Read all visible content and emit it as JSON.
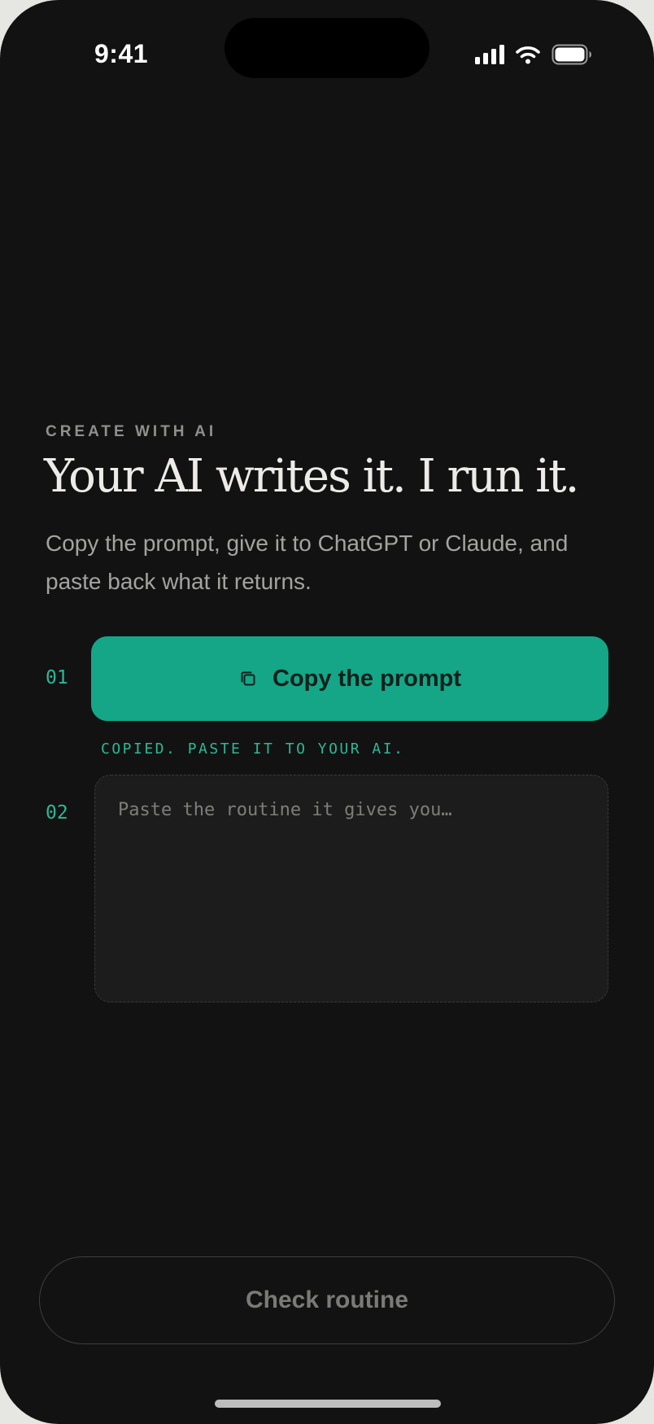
{
  "status_bar": {
    "time": "9:41",
    "icons": [
      "cellular-signal-icon",
      "wifi-icon",
      "battery-icon"
    ]
  },
  "intro": {
    "eyebrow": "CREATE WITH AI",
    "headline": "Your AI writes it. I run it.",
    "subtext": "Copy the prompt, give it to ChatGPT or Claude, and paste back what it returns."
  },
  "steps": [
    {
      "number": "01",
      "button_label": "Copy the prompt",
      "button_icon": "copy-icon",
      "status": "COPIED. PASTE IT TO YOUR AI."
    },
    {
      "number": "02",
      "input_value": "",
      "placeholder": "Paste the routine it gives you…"
    }
  ],
  "footer": {
    "check_label": "Check routine"
  },
  "colors": {
    "background": "#121212",
    "accent": "#14a687",
    "accent_text": "#2bb897"
  }
}
